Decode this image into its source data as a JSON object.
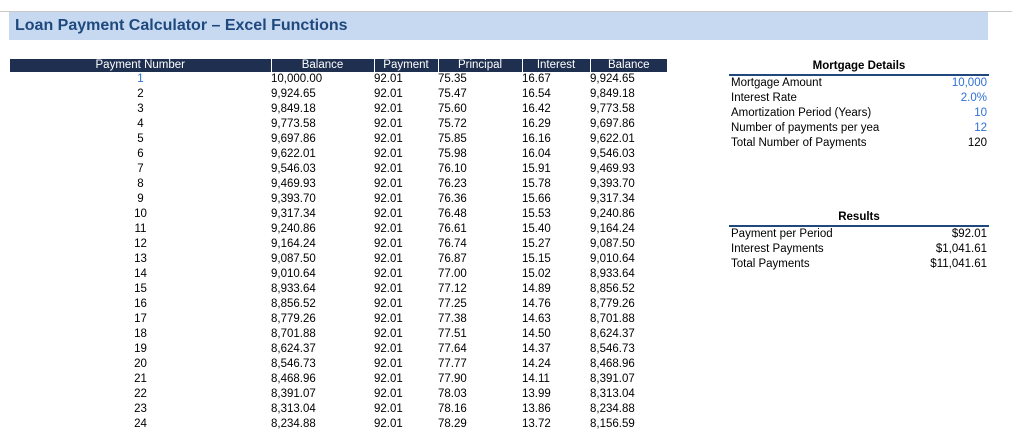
{
  "title": "Loan Payment Calculator – Excel Functions",
  "table": {
    "headers": [
      "Payment Number",
      "Balance",
      "Payment",
      "Principal",
      "Interest",
      "Balance"
    ],
    "rows": [
      [
        "1",
        "10,000.00",
        "92.01",
        "75.35",
        "16.67",
        "9,924.65"
      ],
      [
        "2",
        "9,924.65",
        "92.01",
        "75.47",
        "16.54",
        "9,849.18"
      ],
      [
        "3",
        "9,849.18",
        "92.01",
        "75.60",
        "16.42",
        "9,773.58"
      ],
      [
        "4",
        "9,773.58",
        "92.01",
        "75.72",
        "16.29",
        "9,697.86"
      ],
      [
        "5",
        "9,697.86",
        "92.01",
        "75.85",
        "16.16",
        "9,622.01"
      ],
      [
        "6",
        "9,622.01",
        "92.01",
        "75.98",
        "16.04",
        "9,546.03"
      ],
      [
        "7",
        "9,546.03",
        "92.01",
        "76.10",
        "15.91",
        "9,469.93"
      ],
      [
        "8",
        "9,469.93",
        "92.01",
        "76.23",
        "15.78",
        "9,393.70"
      ],
      [
        "9",
        "9,393.70",
        "92.01",
        "76.36",
        "15.66",
        "9,317.34"
      ],
      [
        "10",
        "9,317.34",
        "92.01",
        "76.48",
        "15.53",
        "9,240.86"
      ],
      [
        "11",
        "9,240.86",
        "92.01",
        "76.61",
        "15.40",
        "9,164.24"
      ],
      [
        "12",
        "9,164.24",
        "92.01",
        "76.74",
        "15.27",
        "9,087.50"
      ],
      [
        "13",
        "9,087.50",
        "92.01",
        "76.87",
        "15.15",
        "9,010.64"
      ],
      [
        "14",
        "9,010.64",
        "92.01",
        "77.00",
        "15.02",
        "8,933.64"
      ],
      [
        "15",
        "8,933.64",
        "92.01",
        "77.12",
        "14.89",
        "8,856.52"
      ],
      [
        "16",
        "8,856.52",
        "92.01",
        "77.25",
        "14.76",
        "8,779.26"
      ],
      [
        "17",
        "8,779.26",
        "92.01",
        "77.38",
        "14.63",
        "8,701.88"
      ],
      [
        "18",
        "8,701.88",
        "92.01",
        "77.51",
        "14.50",
        "8,624.37"
      ],
      [
        "19",
        "8,624.37",
        "92.01",
        "77.64",
        "14.37",
        "8,546.73"
      ],
      [
        "20",
        "8,546.73",
        "92.01",
        "77.77",
        "14.24",
        "8,468.96"
      ],
      [
        "21",
        "8,468.96",
        "92.01",
        "77.90",
        "14.11",
        "8,391.07"
      ],
      [
        "22",
        "8,391.07",
        "92.01",
        "78.03",
        "13.99",
        "8,313.04"
      ],
      [
        "23",
        "8,313.04",
        "92.01",
        "78.16",
        "13.86",
        "8,234.88"
      ],
      [
        "24",
        "8,234.88",
        "92.01",
        "78.29",
        "13.72",
        "8,156.59"
      ]
    ]
  },
  "mortgage": {
    "heading": "Mortgage Details",
    "rows": [
      {
        "label": "Mortgage Amount",
        "value": "10,000"
      },
      {
        "label": "Interest Rate",
        "value": "2.0%"
      },
      {
        "label": "Amortization Period (Years)",
        "value": "10"
      },
      {
        "label": "Number of payments per yea",
        "value": "12"
      },
      {
        "label": "Total Number of Payments",
        "value": "120"
      }
    ]
  },
  "results": {
    "heading": "Results",
    "rows": [
      {
        "label": "Payment per Period",
        "value": "$92.01"
      },
      {
        "label": "Interest Payments",
        "value": "$1,041.61"
      },
      {
        "label": "Total Payments",
        "value": "$11,041.61"
      }
    ]
  },
  "colors": {
    "title_bg": "#c6d9f1",
    "title_text": "#1f497d",
    "header_bg": "#1f2f4f",
    "input_blue": "#2f6fd6"
  }
}
